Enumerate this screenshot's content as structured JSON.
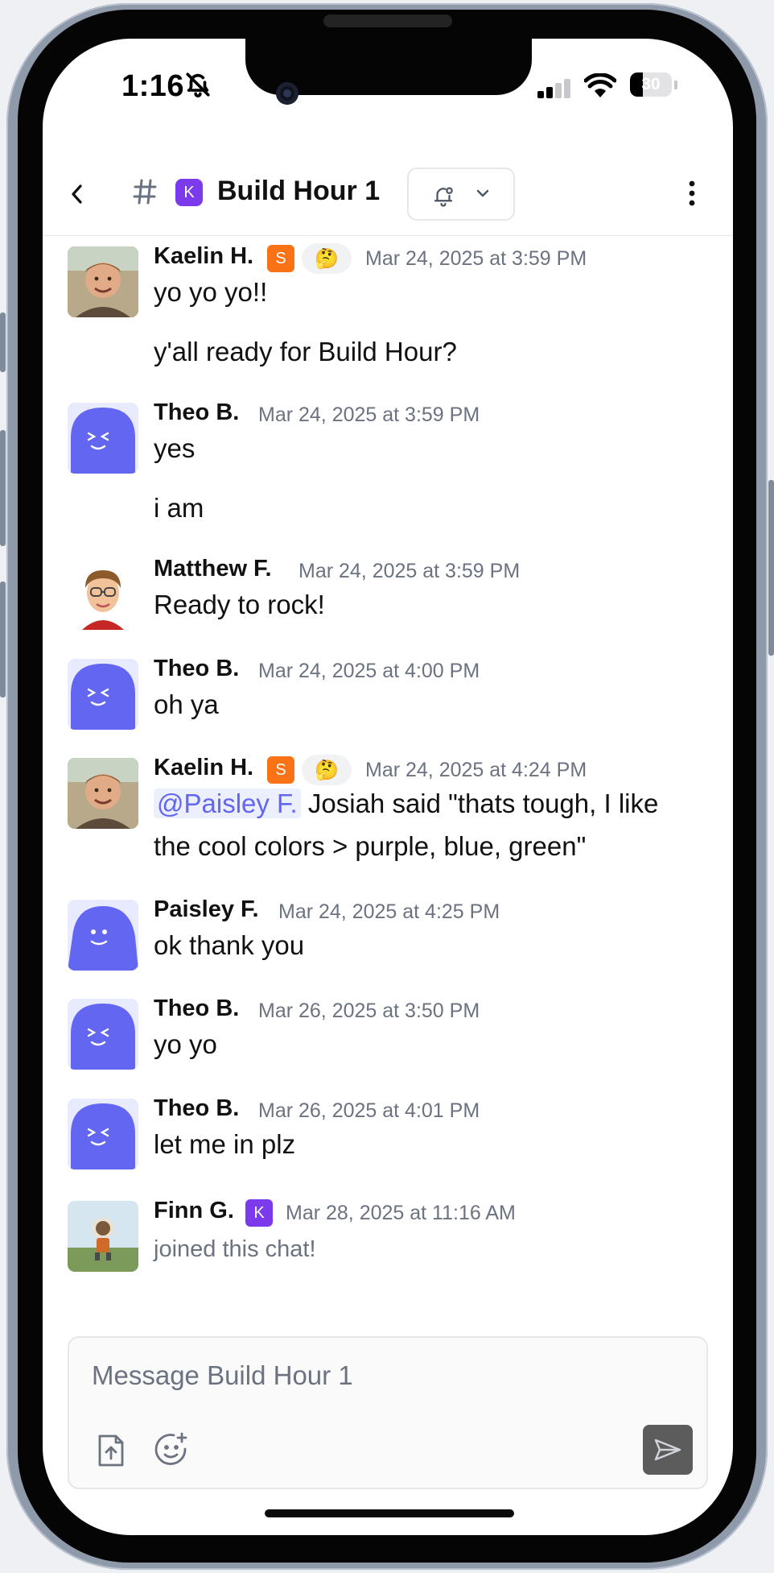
{
  "status_bar": {
    "time": "1:16",
    "battery": "30",
    "battery_level": 0.3
  },
  "header": {
    "channel_badge": "K",
    "title": "Build Hour 1"
  },
  "messages": [
    {
      "author": "Kaelin H.",
      "badge": "S",
      "reaction": "🤔",
      "timestamp": "Mar 24, 2025 at 3:59 PM",
      "lines": [
        "yo yo yo!!",
        "y'all ready for Build Hour?"
      ]
    },
    {
      "author": "Theo B.",
      "timestamp": "Mar 24, 2025 at 3:59 PM",
      "lines": [
        "yes",
        "i am"
      ]
    },
    {
      "author": "Matthew F.",
      "timestamp": "Mar 24, 2025 at 3:59 PM",
      "lines": [
        "Ready to rock!"
      ]
    },
    {
      "author": "Theo B.",
      "timestamp": "Mar 24, 2025 at 4:00 PM",
      "lines": [
        "oh ya"
      ]
    },
    {
      "author": "Kaelin H.",
      "badge": "S",
      "reaction": "🤔",
      "timestamp": "Mar 24, 2025 at 4:24 PM",
      "mention": "@Paisley F.",
      "lines": [
        "Josiah said \"thats tough, I like",
        "the cool colors > purple, blue, green\""
      ]
    },
    {
      "author": "Paisley F.",
      "timestamp": "Mar 24, 2025 at 4:25 PM",
      "lines": [
        "ok thank you"
      ]
    },
    {
      "author": "Theo B.",
      "timestamp": "Mar 26, 2025 at 3:50 PM",
      "lines": [
        "yo yo"
      ]
    },
    {
      "author": "Theo B.",
      "timestamp": "Mar 26, 2025 at 4:01 PM",
      "lines": [
        "let me in plz"
      ]
    },
    {
      "author": "Finn G.",
      "badge": "K",
      "timestamp": "Mar 28, 2025 at 11:16 AM",
      "system_text": "joined this chat!"
    }
  ],
  "composer": {
    "placeholder": "Message Build Hour 1"
  },
  "colors": {
    "accent": "#7c3aed",
    "badge_s": "#f97316",
    "ghost": "#6366f1",
    "mention": "#6366f1"
  }
}
